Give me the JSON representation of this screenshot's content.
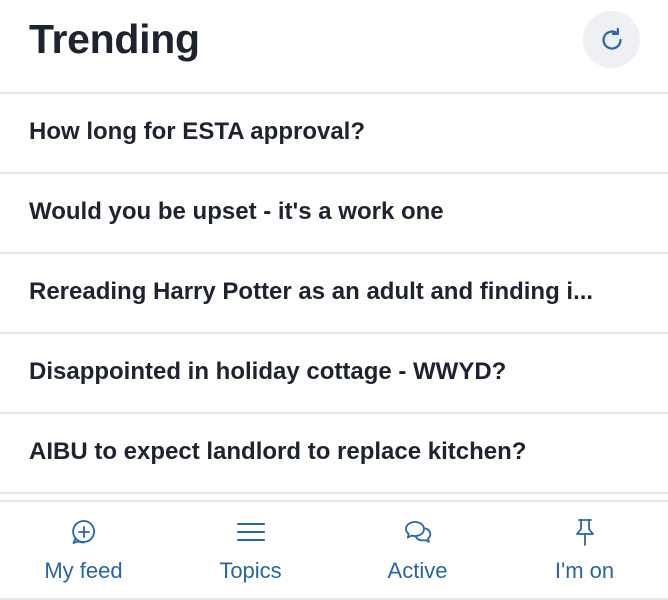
{
  "header": {
    "title": "Trending",
    "refresh_icon": "refresh-icon"
  },
  "threads": [
    {
      "title": "How long for ESTA approval?"
    },
    {
      "title": "Would you be upset - it's a work one"
    },
    {
      "title": "Rereading Harry Potter as an adult and finding i..."
    },
    {
      "title": "Disappointed in holiday cottage - WWYD?"
    },
    {
      "title": "AIBU to expect landlord to replace kitchen?"
    }
  ],
  "tabbar": {
    "tabs": [
      {
        "label": "My feed",
        "icon": "chat-plus-icon"
      },
      {
        "label": "Topics",
        "icon": "menu-icon"
      },
      {
        "label": "Active",
        "icon": "chat-bubbles-icon"
      },
      {
        "label": "I'm on",
        "icon": "pin-icon"
      }
    ]
  },
  "colors": {
    "text": "#1e2330",
    "accent": "#2a64a8",
    "divider": "#e6e6e6",
    "refresh_bg": "#eef0f3"
  }
}
